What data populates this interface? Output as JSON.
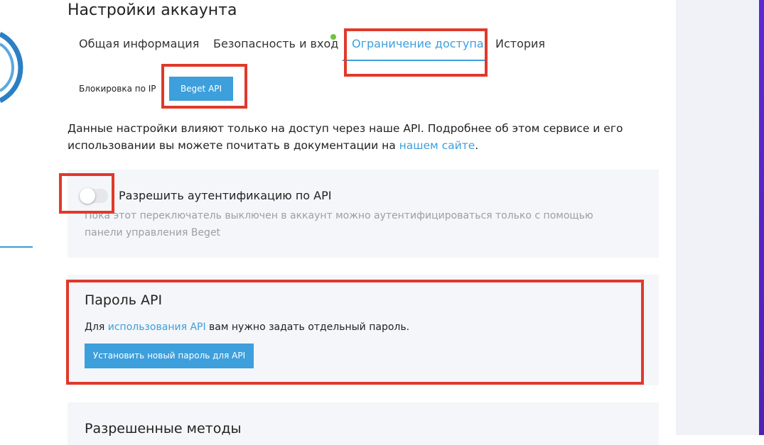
{
  "page": {
    "title": "Настройки аккаунта"
  },
  "tabs": [
    {
      "label": "Общая информация",
      "active": false
    },
    {
      "label": "Безопасность и вход",
      "active": false,
      "has_indicator": true
    },
    {
      "label": "Ограничение доступа",
      "active": true
    },
    {
      "label": "История",
      "active": false
    }
  ],
  "subtabs": [
    {
      "label": "Блокировка по IP",
      "active": false
    },
    {
      "label": "Beget API",
      "active": true
    }
  ],
  "description": {
    "text_before_link": "Данные настройки влияют только на доступ через наше API. Подробнее об этом сервисе и его использовании вы можете почитать в документации на ",
    "link": "нашем сайте",
    "text_after_link": "."
  },
  "api_toggle": {
    "label": "Разрешить аутентификацию по API",
    "enabled": false,
    "hint": "Пока этот переключатель выключен в аккаунт можно аутентифицироваться только с помощью панели управления Beget"
  },
  "api_password": {
    "title": "Пароль API",
    "text_before_link": "Для ",
    "link": "использования API",
    "text_after_link": " вам нужно задать отдельный пароль.",
    "button": "Установить новый пароль для API"
  },
  "allowed_methods": {
    "title": "Разрешенные методы"
  },
  "colors": {
    "accent": "#3d9fdc",
    "highlight": "#e0392b",
    "indicator": "#6ec43c",
    "card_bg": "#f4f6f9",
    "side_panel": "#f0f2f7"
  }
}
